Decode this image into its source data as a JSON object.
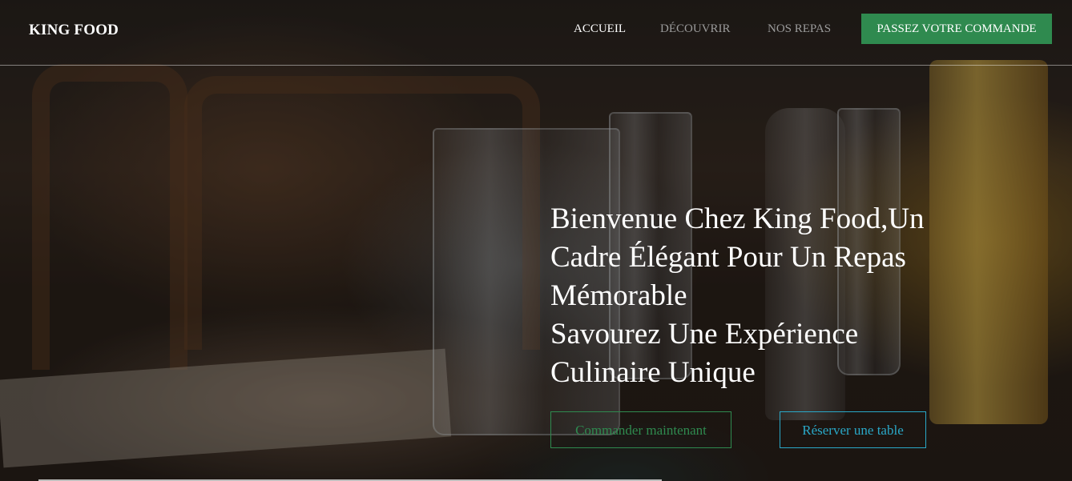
{
  "brand": {
    "name": "KING FOOD"
  },
  "nav": {
    "items": [
      {
        "label": "ACCUEIL",
        "active": true
      },
      {
        "label": "DÉCOUVRIR",
        "active": false
      },
      {
        "label": "NOS REPAS",
        "active": false
      }
    ],
    "order_button": "PASSEZ VOTRE COMMANDE"
  },
  "hero": {
    "headline_lines": [
      "Bienvenue Chez King Food,Un",
      "Cadre Élégant Pour Un Repas",
      "Mémorable",
      "Savourez Une Expérience",
      "Culinaire Unique"
    ],
    "primary_cta": "Commander maintenant",
    "secondary_cta": "Réserver une table"
  },
  "colors": {
    "accent_green": "#2f8a4f",
    "accent_blue": "#2aa8c8",
    "nav_inactive": "#9b9b9b",
    "text": "#ffffff"
  }
}
